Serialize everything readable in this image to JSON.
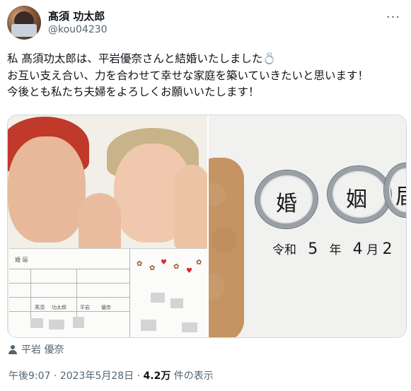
{
  "user": {
    "name": "髙須 功太郎",
    "handle": "@kou04230"
  },
  "tweet": {
    "lines": [
      "私 髙須功太郎は、平岩優奈さんと結婚いたしました💍",
      "お互い支え合い、力を合わせて幸せな家庭を築いていきたいと思います！",
      "今後とも私たち夫婦をよろしくお願いいたします！"
    ]
  },
  "photo_right": {
    "kanji": [
      "婚",
      "姻",
      "届"
    ],
    "date_prefix": "令和",
    "year": "5",
    "year_unit": "年",
    "month": "4",
    "month_unit": "月",
    "day_partial": "2"
  },
  "photo_left": {
    "form_title": "婚 届",
    "names": [
      "髙須",
      "功太郎",
      "平岩",
      "優奈"
    ]
  },
  "tagged_person": "平岩 優奈",
  "meta": {
    "time": "午後9:07",
    "separator": "·",
    "date": "2023年5月28日",
    "views_count": "4.2万",
    "views_label": "件の表示"
  },
  "icons": {
    "more": "more-horizontal-icon",
    "tag": "person-icon"
  }
}
